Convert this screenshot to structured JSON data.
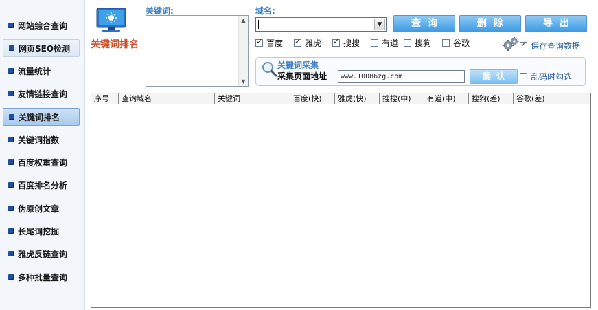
{
  "sidebar": {
    "items": [
      {
        "label": "网站综合查询"
      },
      {
        "label": "网页SEO检测"
      },
      {
        "label": "流量统计"
      },
      {
        "label": "友情链接查询"
      },
      {
        "label": "关键词排名"
      },
      {
        "label": "关键词指数"
      },
      {
        "label": "百度权重查询"
      },
      {
        "label": "百度排名分析"
      },
      {
        "label": "伪原创文章"
      },
      {
        "label": "长尾词挖掘"
      },
      {
        "label": "雅虎反链查询"
      },
      {
        "label": "多种批量查询"
      }
    ]
  },
  "module": {
    "title": "关键词排名"
  },
  "keyword": {
    "label": "关键词:",
    "value": ""
  },
  "domain": {
    "label": "域名:",
    "value": ""
  },
  "toolbar": {
    "query_label": "查询",
    "delete_label": "删除",
    "export_label": "导出"
  },
  "engines": [
    {
      "label": "百度",
      "checked": true
    },
    {
      "label": "雅虎",
      "checked": true
    },
    {
      "label": "搜搜",
      "checked": true
    },
    {
      "label": "有道",
      "checked": false
    },
    {
      "label": "搜狗",
      "checked": false
    },
    {
      "label": "谷歌",
      "checked": false
    }
  ],
  "save_data": {
    "label": "保存查询数据",
    "checked": true
  },
  "collect": {
    "title": "关键词采集",
    "url_label": "采集页面地址",
    "url_value": "www.10086zg.com",
    "confirm_label": "确认",
    "garble_label": "乱码时勾选",
    "garble_checked": false
  },
  "table": {
    "columns": [
      "序号",
      "查询域名",
      "关键词",
      "百度(快)",
      "雅虎(快)",
      "搜搜(中)",
      "有道(中)",
      "搜狗(差)",
      "谷歌(差)"
    ]
  },
  "colors": {
    "accent": "#3a7fc9",
    "title": "#d0502a",
    "button": "#3d9ae4"
  }
}
